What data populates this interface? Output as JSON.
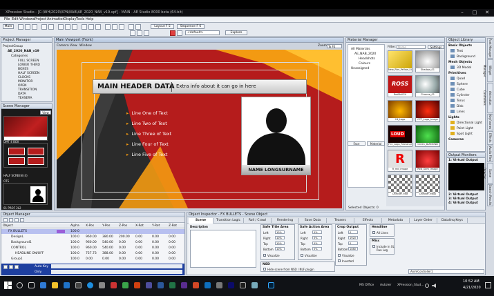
{
  "window": {
    "title": "XPression Studio - [C:\\WH\\2020\\XPN\\NAB\\AE_2020_NAB_v19.xpf] - MAIN · AE Studio 8000 beta (64-bit)",
    "min": "–",
    "max": "□",
    "close": "✕"
  },
  "menu": [
    "File",
    "Edit",
    "Windows",
    "Project",
    "Animation",
    "Display",
    "Tools",
    "Help"
  ],
  "toolbar": {
    "layout_label": "Layout F 5",
    "sequence_label": "Sequence F 6",
    "default_label": "<default>",
    "explore_label": "Explore",
    "main_label": "Main"
  },
  "project_manager": {
    "title": "Project Manager",
    "root": "ProjectGroup",
    "project": "AE_2020_NAB_v19",
    "category": "Categories",
    "items": [
      "FULL SCREEN",
      "LOWER THIRD",
      "BOXES",
      "HALF SCREEN",
      "CLOCKS",
      "MONITOR",
      "OPEN",
      "TRANSITION",
      "DATA",
      "TEASERA"
    ]
  },
  "scene_manager": {
    "title": "Scene Manager",
    "view_label": "View",
    "thumbs": [
      "",
      "DMT 4 BOX",
      "HALF SCREEN (4)",
      "OTS"
    ],
    "footer_label": "01 PROF 2L2"
  },
  "viewport": {
    "title": "Main Viewport (Front)",
    "tabs": [
      "Camera",
      "View",
      "Window"
    ],
    "zoom_label": "Zoom:",
    "zoom_value": "To Fit",
    "graphic": {
      "header": "MAIN HEADER DATA",
      "subheader": "Extra info about it can go in here",
      "lines": [
        "Line One of Text",
        "Line Two of Text",
        "Line Three of Text",
        "Line Four of Text",
        "Line Five of Text"
      ],
      "name": "NAME LONGSURNAME"
    }
  },
  "material_manager": {
    "title": "Material Manager",
    "tree": [
      "All Materials",
      "AE_NAB_2020",
      "Headshots",
      "Colours",
      "Unassigned"
    ],
    "filter_label": "Filter:",
    "filter_placeholder": "Name",
    "settings_label": "Settings",
    "tiles": [
      "New_Rbn_Yellow_Lin",
      "Shadow_01",
      "RedBullCH",
      "Chrome_01",
      "C4_Logo",
      "OTT_Logo_Image",
      "Fire_Logo_Rectangl",
      "Green_DIAMOND",
      "R_red_image",
      "Red_Gem_Image",
      "Checker_Mat",
      "Checker_Mat2"
    ],
    "status": "Selected Objects: 0",
    "tabs": [
      "Face",
      "Material"
    ]
  },
  "object_library": {
    "title": "Object Library",
    "basic_header": "Basic Objects",
    "basic": [
      "Text",
      "Background"
    ],
    "mesh_header": "Mesh Objects",
    "mesh": [
      "3D Model"
    ],
    "primitives_header": "Primitives",
    "primitives": [
      "Quad",
      "Sphere",
      "Cube",
      "Cylinder",
      "Torus",
      "Disk",
      "Lines"
    ],
    "lights_header": "Lights",
    "lights": [
      "Directional Light",
      "Point Light",
      "Spot Light"
    ],
    "cameras_header": "Cameras",
    "monitors_title": "Output Monitors",
    "outputs": [
      "1: Virtual Output",
      "2: Virtual Output",
      "3: Virtual Output",
      "4: Virtual Output"
    ],
    "side_tabs": [
      "Font Manager",
      "Widget Manager",
      "Animation Controllers",
      "Keyframes",
      "Effects",
      "Audio Files",
      "Scene Director",
      "Search Results"
    ]
  },
  "object_manager": {
    "title": "Object Manager",
    "columns": [
      "Object",
      "",
      "Alpha",
      "X-Pos",
      "Y-Pos",
      "Z-Pos",
      "X-Rot",
      "Y-Rot",
      "Z-Rot"
    ],
    "rows": [
      [
        "FX BULLETS",
        "",
        "100.0",
        "",
        "",
        "",
        "",
        "",
        ""
      ],
      [
        "DesignL",
        "",
        "100.0",
        "960.00",
        "380.00",
        "200.00",
        "0.00",
        "0.00",
        "0.00"
      ],
      [
        "Background1",
        "",
        "100.0",
        "960.00",
        "540.00",
        "0.00",
        "0.00",
        "0.00",
        "0.00"
      ],
      [
        "CONTROL",
        "",
        "100.0",
        "960.00",
        "540.00",
        "0.00",
        "0.00",
        "0.00",
        "0.00"
      ],
      [
        "HEADLINE ON/OFF",
        "",
        "100.0",
        "757.73",
        "388.00",
        "0.00",
        "0.00",
        "0.00",
        "0.00"
      ],
      [
        "Group1",
        "",
        "100.0",
        "0.00",
        "0.00",
        "0.00",
        "0.00",
        "0.00",
        "0.00"
      ]
    ],
    "autokey_label": "Auto Key",
    "only_label": "Only"
  },
  "inspector": {
    "title": "Object Inspector - FX BULLETS - Scene Object",
    "tabs": [
      "Scene",
      "Transition Logic",
      "Roll / Crawl",
      "Rendering",
      "Save Data",
      "Teasers",
      "Effects",
      "Metadata",
      "Layer Order",
      "Datalinq Keys"
    ],
    "description_label": "Description",
    "safe_title": {
      "title": "Safe Title Area",
      "rows": [
        [
          "Left",
          "10%"
        ],
        [
          "Right",
          "10%"
        ],
        [
          "Top",
          "10%"
        ],
        [
          "Bottom",
          "10%"
        ]
      ],
      "visualize": "Visualize"
    },
    "safe_action": {
      "title": "Safe Action Area",
      "rows": [
        [
          "Left",
          "5%"
        ],
        [
          "Right",
          "5%"
        ],
        [
          "Top",
          "5%"
        ],
        [
          "Bottom",
          "5%"
        ]
      ],
      "visualize": "Visualize"
    },
    "crop": {
      "title": "Crop Output",
      "rows": [
        [
          "Left",
          "0"
        ],
        [
          "Right",
          "1920"
        ],
        [
          "Top",
          "0"
        ],
        [
          "Bottom",
          "1080"
        ]
      ],
      "visualize": "Visualize",
      "inverted": "Inverted"
    },
    "nsd_title": "NSD",
    "nsd_option": "Hide scene from NSD / NLF plugin",
    "headline": {
      "title": "Headline",
      "option": "All Lines"
    },
    "misc": {
      "title": "Misc",
      "option": "Include in XL Run Log"
    }
  },
  "status_bar": {
    "anim_label": "AnimController1"
  },
  "taskbar": {
    "apps": [
      "MS Office",
      "Autoler",
      "XPression_Stud..."
    ],
    "time": "10:52 AM",
    "date": "4/21/2020"
  }
}
